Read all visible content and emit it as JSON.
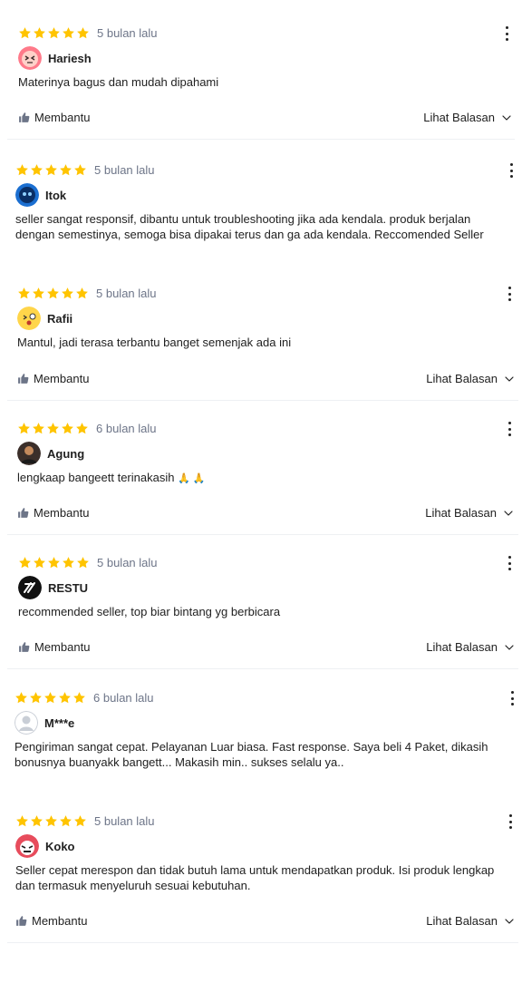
{
  "reviews": [
    {
      "time": "5 bulan lalu",
      "user": "Hariesh",
      "text": "Materinya bagus dan mudah dipahami",
      "helpful": "Membantu",
      "replies": "Lihat Balasan",
      "stars": 5
    },
    {
      "time": "5 bulan lalu",
      "user": "Itok",
      "text": "seller sangat responsif, dibantu untuk troubleshooting jika ada kendala. produk berjalan dengan semestinya, semoga bisa dipakai terus dan ga ada kendala. Reccomended Seller",
      "stars": 5
    },
    {
      "time": "5 bulan lalu",
      "user": "Rafii",
      "text": "Mantul, jadi terasa terbantu banget semenjak ada ini",
      "helpful": "Membantu",
      "replies": "Lihat Balasan",
      "stars": 5
    },
    {
      "time": "6 bulan lalu",
      "user": "Agung",
      "text": "lengkaap bangeett terinakasih",
      "emoji": "🙏 🙏",
      "helpful": "Membantu",
      "replies": "Lihat Balasan",
      "stars": 5
    },
    {
      "time": "5 bulan lalu",
      "user": "RESTU",
      "text": "recommended seller, top biar bintang yg berbicara",
      "helpful": "Membantu",
      "replies": "Lihat Balasan",
      "stars": 5
    },
    {
      "time": "6 bulan lalu",
      "user": "M***e",
      "text": "Pengiriman sangat cepat. Pelayanan Luar biasa. Fast response. Saya beli 4 Paket, dikasih bonusnya buanyakk bangett... Makasih min.. sukses selalu ya..",
      "stars": 5
    },
    {
      "time": "5 bulan lalu",
      "user": "Koko",
      "text": "Seller cepat merespon dan tidak butuh lama untuk mendapatkan produk. Isi produk lengkap dan termasuk menyeluruh sesuai kebutuhan.",
      "helpful": "Membantu",
      "replies": "Lihat Balasan",
      "stars": 5
    }
  ],
  "colors": {
    "star": "#ffc400",
    "muted": "#6d7588",
    "text": "#212121",
    "divider": "#eef0f3"
  },
  "icons": {
    "star": "star-icon",
    "more": "more-vertical-icon",
    "helpful": "thumbs-up-icon",
    "chevron": "chevron-down-icon"
  }
}
